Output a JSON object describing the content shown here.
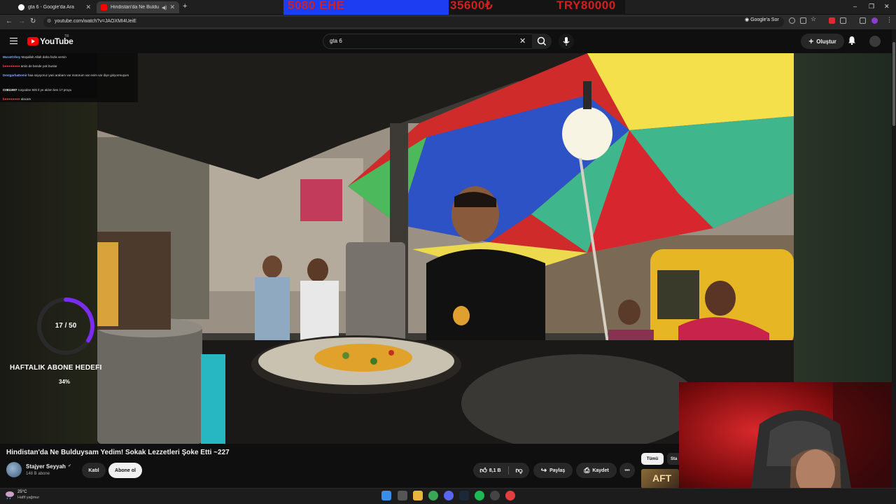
{
  "browser": {
    "tabs": [
      {
        "title": "gta 6 - Google'da Ara",
        "active": false
      },
      {
        "title": "Hindistan'da Ne Bulduysam",
        "active": true
      }
    ],
    "url": "youtube.com/watch?v=JAOXMI4UeiE",
    "google_ask": "Google'a Sor"
  },
  "banner": {
    "left_text": "5080 EHE",
    "mid_text": "35600₺",
    "right_text": "TRY80000"
  },
  "masthead": {
    "logo_text": "YouTube",
    "country_code": "TR",
    "search_value": "gta 6",
    "create_label": "Oluştur"
  },
  "chat": [
    {
      "user": "MuratOrbey",
      "text": "Maşallah Allah daha fazla versin",
      "color": "#7fb3ff"
    },
    {
      "user": "b●●●●●●●●",
      "text": "amin de bende yok bunlar",
      "color": "#ff4b4b"
    },
    {
      "user": "DestgarhaDemir",
      "text": "haa sayıyoruz yani arabam var motorum var evim var diye giriyormuşum",
      "color": "#7fb3ff"
    },
    {
      "user": "C0811907",
      "text": "rusyadan 80k tl ye aldım ben 17 proyu",
      "color": "#ffffff"
    },
    {
      "user": "b●●●●●●●●",
      "text": "alacam",
      "color": "#ff4b4b"
    }
  ],
  "goal": {
    "count": "17 / 50",
    "title": "HAFTALIK ABONE HEDEFI",
    "percent": "34%",
    "progress": 0.34
  },
  "video": {
    "title": "Hindistan'da Ne Bulduysam Yedim! Sokak Lezzetleri Şoke Etti ~227",
    "channel": "Stajyer Seyyah",
    "subscribers": "148 B abone",
    "join_label": "Katıl",
    "subscribe_label": "Abone ol",
    "likes": "8,1 B",
    "share_label": "Paylaş",
    "save_label": "Kaydet"
  },
  "related": {
    "chip_all": "Tümü",
    "chip_next": "Sta",
    "thumb_text": "AFT"
  },
  "taskbar": {
    "temp": "25°C",
    "condition": "Hafif yağmur"
  },
  "colors": {
    "yt_red": "#ff0000",
    "banner_blue": "#1d3df2",
    "banner_red": "#d21f1f",
    "goal_purple": "#7a2cf0"
  }
}
